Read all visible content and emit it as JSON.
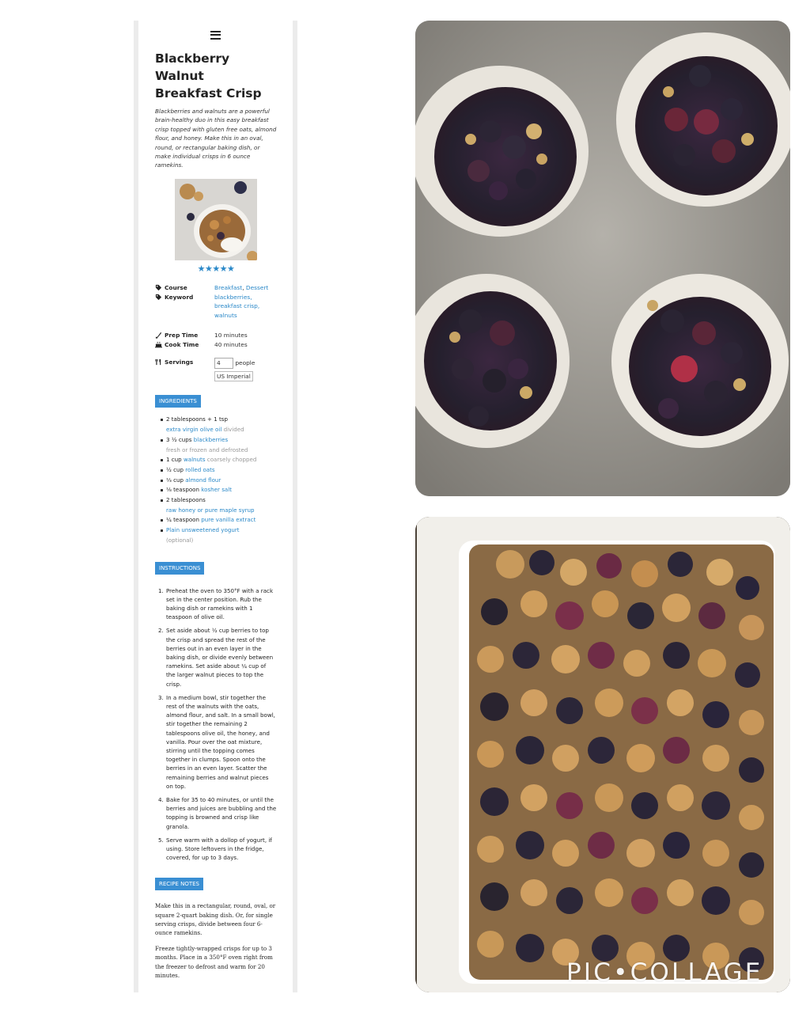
{
  "recipe": {
    "title_line1": "Blackberry Walnut",
    "title_line2": "Breakfast Crisp",
    "summary": "Blackberries and walnuts are a powerful brain-healthy duo in this easy breakfast crisp topped with gluten free oats, almond flour, and honey. Make this in an oval, round, or rectangular baking dish, or make individual crisps in 6 ounce ramekins.",
    "rating_stars": "★★★★★",
    "course_label": "Course",
    "course_value1": "Breakfast",
    "course_sep": ", ",
    "course_value2": "Dessert",
    "keyword_label": "Keyword",
    "keyword_value1": "blackberries,",
    "keyword_value2": "breakfast crisp,",
    "keyword_value3": "walnuts",
    "prep_label": "Prep Time",
    "prep_value": "10 minutes",
    "cook_label": "Cook Time",
    "cook_value": "40 minutes",
    "servings_label": "Servings",
    "servings_value": "4",
    "servings_unit": "people",
    "units_toggle": "US Imperial"
  },
  "ingredients": {
    "heading": "INGREDIENTS",
    "items": [
      {
        "main": "2 tablespoons + 1 tsp",
        "link": "extra virgin olive oil",
        "note": "divided"
      },
      {
        "main": "3 ½ cups ",
        "link": "blackberries",
        "note": "fresh or frozen and defrosted"
      },
      {
        "main": "1 cup ",
        "link": "walnuts",
        "note": "coarsely chopped"
      },
      {
        "main": "½ cup ",
        "link": "rolled oats",
        "note": ""
      },
      {
        "main": "⅓ cup ",
        "link": "almond flour",
        "note": ""
      },
      {
        "main": "⅛ teaspoon ",
        "link": "kosher salt",
        "note": ""
      },
      {
        "main": "2 tablespoons",
        "link": "raw honey or pure maple syrup",
        "note": ""
      },
      {
        "main": "¼ teaspoon ",
        "link": "pure vanilla extract",
        "note": ""
      },
      {
        "main": "",
        "link": "Plain unsweetened yogurt",
        "note": "(optional)"
      }
    ]
  },
  "instructions": {
    "heading": "INSTRUCTIONS",
    "steps": [
      "Preheat the oven to 350°F with a rack set in the center position. Rub the baking dish or ramekins with 1 teaspoon of olive oil.",
      "Set aside about ½ cup berries to top the crisp and spread the rest of the berries out in an even layer in the baking dish, or divide evenly between ramekins. Set aside about ¼ cup of the larger walnut pieces to top the crisp.",
      "In a medium bowl, stir together the rest of the walnuts with the oats, almond flour, and salt. In a small bowl, stir together the remaining 2 tablespoons olive oil, the honey, and vanilla. Pour over the oat mixture, stirring until the topping comes together in clumps. Spoon onto the berries in an even layer. Scatter the remaining berries and walnut pieces on top.",
      "Bake for 35 to 40 minutes, or until the berries and juices are bubbling and the topping is browned and crisp like granola.",
      "Serve warm with a dollop of yogurt, if using. Store leftovers in the fridge, covered, for up to 3 days."
    ]
  },
  "notes": {
    "heading": "RECIPE NOTES",
    "para1": "Make this in a rectangular, round, oval, or square 2-quart baking dish. Or, for single serving crisps, divide between four 6-ounce ramekins.",
    "para2": "Freeze tightly-wrapped crisps for up to 3 months. Place in a 350°F oven right from the freezer to defrost and warm for 20 minutes."
  },
  "watermark": "PIC•COLLAGE",
  "colors": {
    "accent": "#3a8fd3",
    "link": "#2a88c8",
    "star": "#2a88c8"
  }
}
